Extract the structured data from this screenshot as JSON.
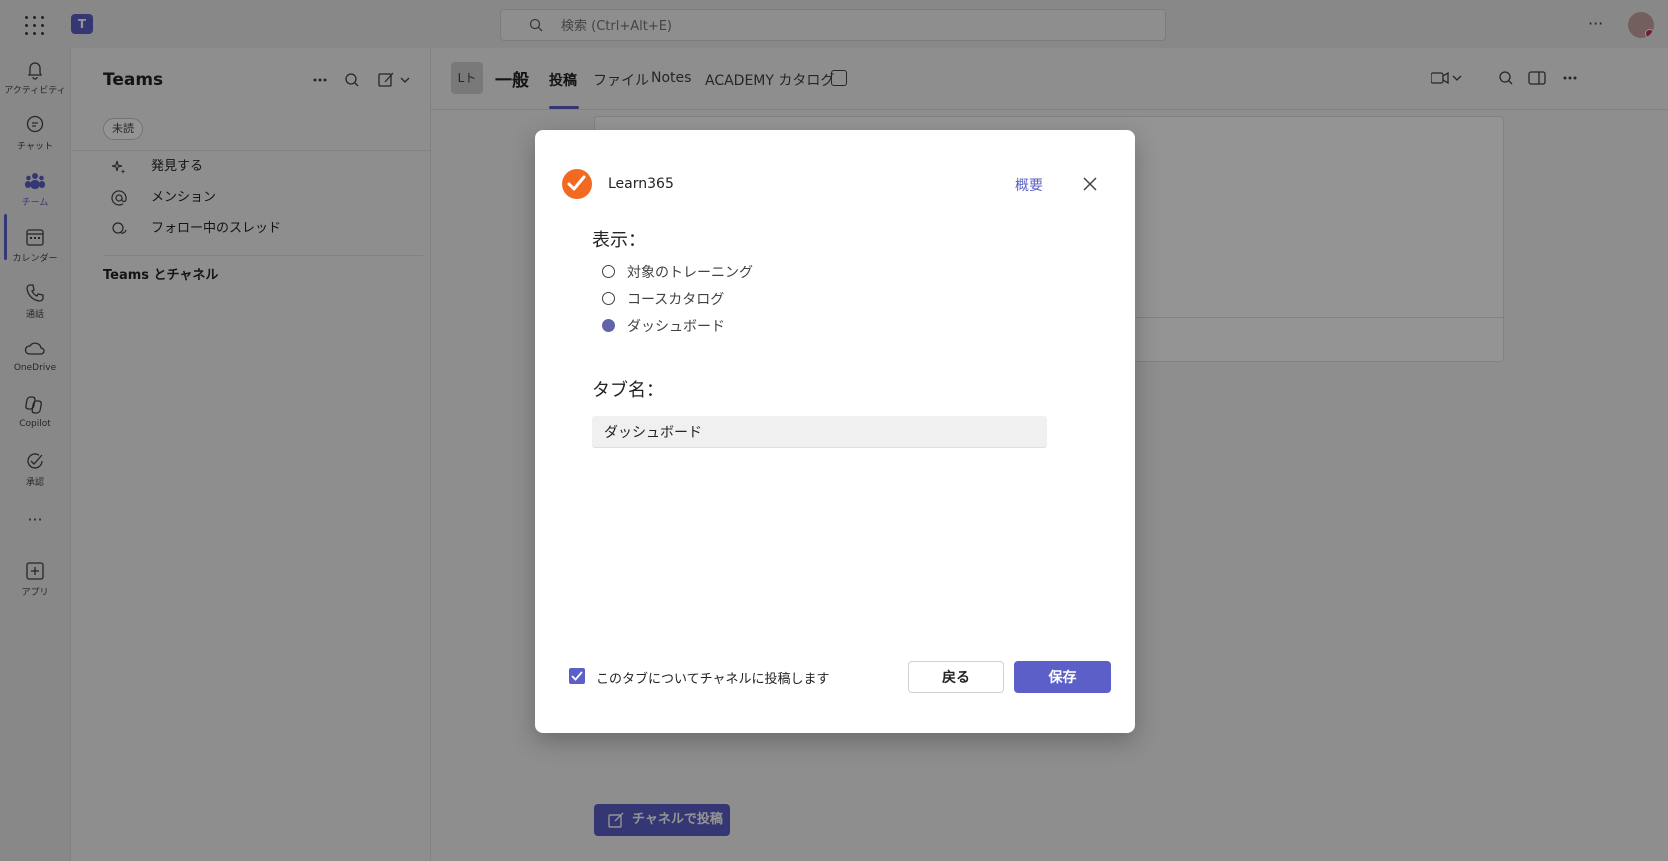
{
  "topbar": {
    "search_placeholder": "検索 (Ctrl+Alt+E)",
    "more_label": "···"
  },
  "rail": {
    "items": [
      {
        "label": "アクティビティ",
        "icon": "bell-icon"
      },
      {
        "label": "チャット",
        "icon": "chat-icon"
      },
      {
        "label": "チーム",
        "icon": "teams-icon"
      },
      {
        "label": "カレンダー",
        "icon": "calendar-icon"
      },
      {
        "label": "通話",
        "icon": "phone-icon"
      },
      {
        "label": "OneDrive",
        "icon": "cloud-icon"
      },
      {
        "label": "Copilot",
        "icon": "copilot-icon"
      },
      {
        "label": "承認",
        "icon": "approval-icon"
      },
      {
        "label": "アプリ",
        "icon": "add-apps-icon"
      }
    ],
    "more_label": "···"
  },
  "sidepanel": {
    "title": "Teams",
    "unread_chip": "未読",
    "rows": [
      {
        "label": "発見する",
        "icon": "sparkle-icon"
      },
      {
        "label": "メンション",
        "icon": "at-icon"
      },
      {
        "label": "フォロー中のスレッド",
        "icon": "threads-icon"
      }
    ],
    "section": "Teams とチャネル"
  },
  "main": {
    "channel_avatar": "Lト",
    "channel_name": "一般",
    "tabs": [
      "投稿",
      "ファイル",
      "Notes",
      "ACADEMY カタログ"
    ],
    "post_button": "チャネルで投稿"
  },
  "dialog": {
    "app_name": "Learn365",
    "about_link": "概要",
    "display_label": "表示：",
    "options": [
      {
        "label": "対象のトレーニング",
        "selected": false
      },
      {
        "label": "コースカタログ",
        "selected": false
      },
      {
        "label": "ダッシュボード",
        "selected": true
      }
    ],
    "tabname_label": "タブ名：",
    "tabname_value": "ダッシュボード",
    "post_checkbox_label": "このタブについてチャネルに投稿します",
    "post_checkbox_checked": true,
    "back_button": "戻る",
    "save_button": "保存"
  },
  "colors": {
    "accent": "#5b5fc7",
    "logo_orange": "#f26a21",
    "radio_selected": "#6264a7"
  }
}
